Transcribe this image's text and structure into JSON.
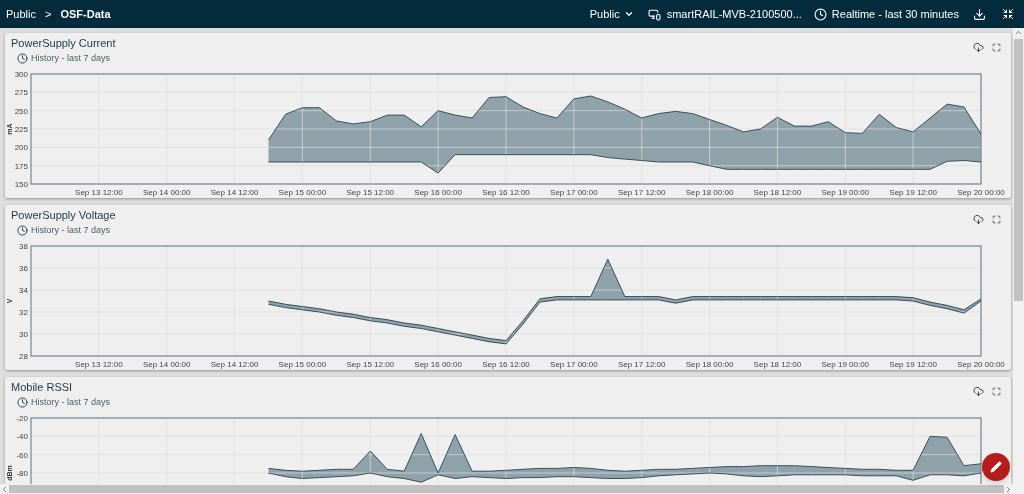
{
  "header": {
    "breadcrumbs": [
      {
        "label": "Public",
        "current": false
      },
      {
        "label": "OSF-Data",
        "current": true
      }
    ],
    "separator": ">",
    "scope": {
      "label": "Public"
    },
    "device": {
      "label": "smartRAIL-MVB-2100500..."
    },
    "time_range": {
      "label": "Realtime - last 30 minutes"
    }
  },
  "panels": [
    {
      "title": "PowerSupply Current",
      "subtitle": "History - last 7 days",
      "chart_data": {
        "type": "line",
        "grid": true,
        "ylabel": "mA",
        "ylim": [
          150,
          300
        ],
        "yticks": [
          150,
          175,
          200,
          225,
          250,
          275,
          300
        ],
        "categories": [
          null,
          null,
          null,
          null,
          "Sep 13 12:00",
          null,
          null,
          null,
          "Sep 14 00:00",
          null,
          null,
          null,
          "Sep 14 12:00",
          null,
          null,
          null,
          "Sep 15 00:00",
          null,
          null,
          null,
          "Sep 15 12:00",
          null,
          null,
          null,
          "Sep 16 00:00",
          null,
          null,
          null,
          "Sep 16 12:00",
          null,
          null,
          null,
          "Sep 17 00:00",
          null,
          null,
          null,
          "Sep 17 12:00",
          null,
          null,
          null,
          "Sep 18 00:00",
          null,
          null,
          null,
          "Sep 18 12:00",
          null,
          null,
          null,
          "Sep 19 00:00",
          null,
          null,
          null,
          "Sep 19 12:00",
          null,
          null,
          null,
          "Sep 20 00:00"
        ],
        "series": [
          {
            "color": "#37505c",
            "values": [
              null,
              null,
              null,
              null,
              null,
              null,
              null,
              null,
              null,
              null,
              null,
              null,
              null,
              null,
              210,
              245,
              254,
              254,
              236,
              232,
              235,
              244,
              244,
              228,
              250,
              244,
              240,
              268,
              269,
              255,
              246,
              240,
              266,
              270,
              262,
              252,
              240,
              246,
              249,
              246,
              238,
              230,
              221,
              225,
              241,
              229,
              229,
              235,
              220,
              219,
              245,
              227,
              221,
              240,
              259,
              255,
              218
            ]
          },
          {
            "color": "#37505c",
            "values": [
              null,
              null,
              null,
              null,
              null,
              null,
              null,
              null,
              null,
              null,
              null,
              null,
              null,
              null,
              180,
              180,
              180,
              180,
              180,
              180,
              180,
              180,
              180,
              180,
              165,
              190,
              190,
              190,
              190,
              190,
              190,
              190,
              190,
              190,
              186,
              184,
              182,
              180,
              180,
              180,
              175,
              170,
              170,
              170,
              170,
              170,
              170,
              170,
              170,
              170,
              170,
              170,
              170,
              170,
              181,
              182,
              180
            ]
          }
        ]
      }
    },
    {
      "title": "PowerSupply Voltage",
      "subtitle": "History - last 7 days",
      "chart_data": {
        "type": "line",
        "grid": true,
        "ylabel": "V",
        "ylim": [
          28,
          38
        ],
        "yticks": [
          28,
          30,
          32,
          34,
          36,
          38
        ],
        "categories": [
          null,
          null,
          null,
          null,
          "Sep 13 12:00",
          null,
          null,
          null,
          "Sep 14 00:00",
          null,
          null,
          null,
          "Sep 14 12:00",
          null,
          null,
          null,
          "Sep 15 00:00",
          null,
          null,
          null,
          "Sep 15 12:00",
          null,
          null,
          null,
          "Sep 16 00:00",
          null,
          null,
          null,
          "Sep 16 12:00",
          null,
          null,
          null,
          "Sep 17 00:00",
          null,
          null,
          null,
          "Sep 17 12:00",
          null,
          null,
          null,
          "Sep 18 00:00",
          null,
          null,
          null,
          "Sep 18 12:00",
          null,
          null,
          null,
          "Sep 19 00:00",
          null,
          null,
          null,
          "Sep 19 12:00",
          null,
          null,
          null,
          "Sep 20 00:00"
        ],
        "series": [
          {
            "color": "#37505c",
            "values": [
              null,
              null,
              null,
              null,
              null,
              null,
              null,
              null,
              null,
              null,
              null,
              null,
              null,
              null,
              33,
              32.7,
              32.5,
              32.3,
              32,
              31.8,
              31.5,
              31.3,
              31,
              30.8,
              30.5,
              30.2,
              29.9,
              29.6,
              29.4,
              31.2,
              33.2,
              33.4,
              33.4,
              33.4,
              36.8,
              33.4,
              33.4,
              33.4,
              33.1,
              33.4,
              33.4,
              33.4,
              33.4,
              33.4,
              33.4,
              33.4,
              33.4,
              33.4,
              33.4,
              33.4,
              33.4,
              33.4,
              33.3,
              32.9,
              32.6,
              32.2,
              33.2
            ]
          },
          {
            "color": "#37505c",
            "values": [
              null,
              null,
              null,
              null,
              null,
              null,
              null,
              null,
              null,
              null,
              null,
              null,
              null,
              null,
              32.7,
              32.4,
              32.2,
              32,
              31.7,
              31.5,
              31.2,
              31,
              30.7,
              30.5,
              30.2,
              29.9,
              29.6,
              29.3,
              29.1,
              30.9,
              32.9,
              33.1,
              33.1,
              33.1,
              33.1,
              33.1,
              33.1,
              33.1,
              32.8,
              33.1,
              33.1,
              33.1,
              33.1,
              33.1,
              33.1,
              33.1,
              33.1,
              33.1,
              33.1,
              33.1,
              33.1,
              33.1,
              33,
              32.6,
              32.3,
              31.9,
              33
            ]
          }
        ]
      }
    },
    {
      "title": "Mobile RSSI",
      "subtitle": "History - last 7 days",
      "chart_data": {
        "type": "line",
        "grid": true,
        "ylabel": "dBm",
        "ylim": [
          -140,
          -20
        ],
        "yticks": [
          -80,
          -60,
          -40,
          -20
        ],
        "series": [
          {
            "color": "#37505c",
            "values": [
              null,
              null,
              null,
              null,
              null,
              null,
              null,
              null,
              null,
              null,
              null,
              null,
              null,
              null,
              -75,
              -77,
              -78,
              -77,
              -76,
              -76,
              -56,
              -76,
              -78,
              -37,
              -80,
              -38,
              -78,
              -78,
              -77,
              -76,
              -75,
              -75,
              -74,
              -75,
              -77,
              -78,
              -77,
              -76,
              -76,
              -75,
              -74,
              -73,
              -73,
              -72,
              -72,
              -72,
              -73,
              -74,
              -75,
              -76,
              -76,
              -77,
              -77,
              -40,
              -41,
              -72,
              -70
            ]
          },
          {
            "color": "#37505c",
            "values": [
              null,
              null,
              null,
              null,
              null,
              null,
              null,
              null,
              null,
              null,
              null,
              null,
              null,
              null,
              -80,
              -84,
              -86,
              -85,
              -84,
              -83,
              -80,
              -84,
              -86,
              -90,
              -82,
              -86,
              -84,
              -85,
              -86,
              -85,
              -85,
              -84,
              -84,
              -85,
              -86,
              -86,
              -85,
              -83,
              -82,
              -81,
              -80,
              -81,
              -83,
              -84,
              -83,
              -82,
              -82,
              -82,
              -82,
              -83,
              -83,
              -83,
              -88,
              -82,
              -82,
              -83,
              -80
            ]
          }
        ]
      }
    }
  ]
}
